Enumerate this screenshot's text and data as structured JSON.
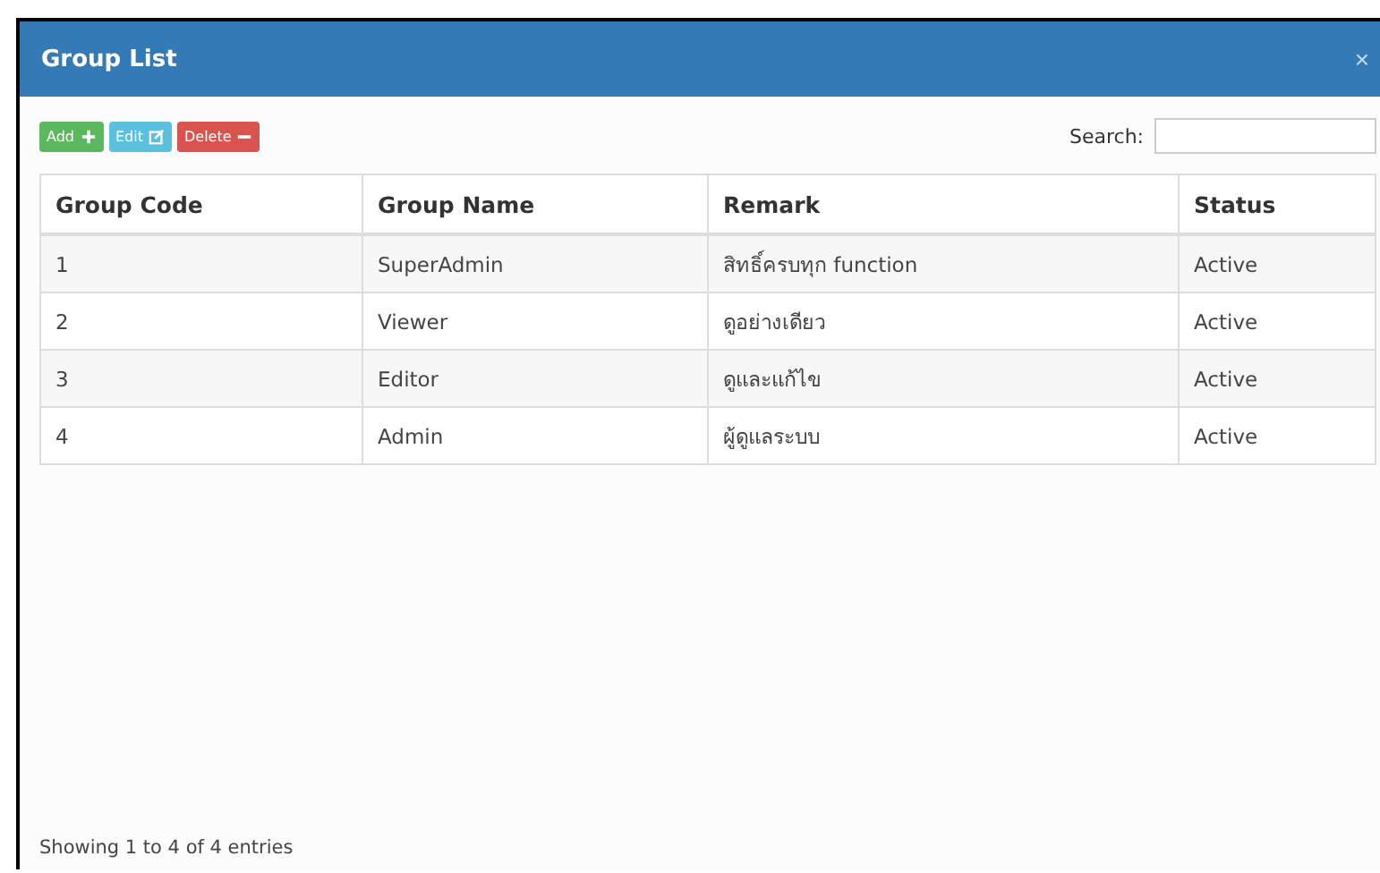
{
  "window": {
    "title": "Group List",
    "close": "×"
  },
  "toolbar": {
    "buttons": [
      {
        "label": "Add",
        "kind": "add"
      },
      {
        "label": "Edit",
        "kind": "edit"
      },
      {
        "label": "Delete",
        "kind": "delete"
      }
    ],
    "search_label": "Search:"
  },
  "table": {
    "columns": [
      "Group Code",
      "Group Name",
      "Remark",
      "Status"
    ],
    "rows": [
      [
        "1",
        "SuperAdmin",
        "สิทธิ์ครบทุก function",
        "Active"
      ],
      [
        "2",
        "Viewer",
        "ดูอย่างเดียว",
        "Active"
      ],
      [
        "3",
        "Editor",
        "ดูและแก้ไข",
        "Active"
      ],
      [
        "4",
        "Admin",
        "ผู้ดูแลระบบ",
        "Active"
      ]
    ]
  },
  "footer": "Showing 1 to 4 of 4 entries"
}
